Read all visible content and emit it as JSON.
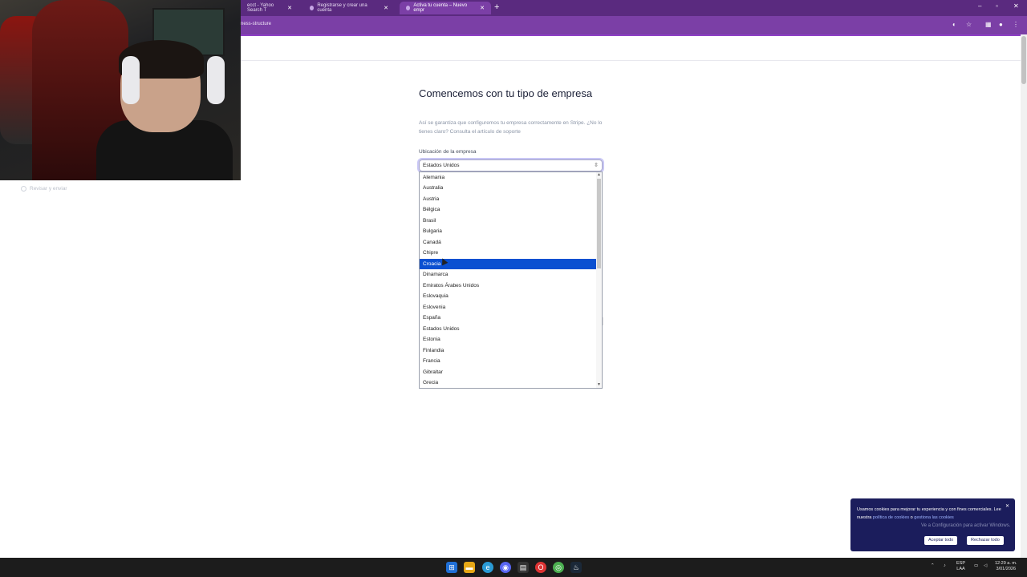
{
  "browser": {
    "tabs": [
      {
        "label": "ecct - Yahoo Search T",
        "active": false
      },
      {
        "label": "Registrarse y crear una cuenta",
        "active": false
      },
      {
        "label": "Activa tu cuenta – Nuevo empr",
        "active": true
      }
    ],
    "url_fragment": "ness-structure"
  },
  "page": {
    "title": "Comencemos con tu tipo de empresa",
    "subtitle": "Así se garantiza que configuremos tu empresa correctamente en Stripe. ¿No lo tienes claro? Consulta el artículo de soporte",
    "location_label": "Ubicación de la empresa",
    "selected_country": "Estados Unidos",
    "countries": [
      "Alemania",
      "Australia",
      "Austria",
      "Bélgica",
      "Brasil",
      "Bulgaria",
      "Canadá",
      "Chipre",
      "Croacia",
      "Dinamarca",
      "Emiratos Árabes Unidos",
      "Eslovaquia",
      "Eslovenia",
      "España",
      "Estados Unidos",
      "Estonia",
      "Finlandia",
      "Francia",
      "Gibraltar",
      "Grecia"
    ],
    "highlighted_country": "Croacia",
    "review_step": "Revisar y enviar"
  },
  "cookie_banner": {
    "text_before": "Usamos cookies para mejorar tu experiencia y con fines comerciales. Lee nuestra",
    "link1": "política de cookies",
    "text_mid": "o",
    "link2": "gestiona las cookies",
    "overlay_text": "Ve a Configuración para activar Windows.",
    "accept": "Aceptar todo",
    "reject": "Rechazar todo"
  },
  "taskbar": {
    "lang": "ESP",
    "lang2": "LAA",
    "time": "12:29 a. m.",
    "date": "3/01/2026"
  },
  "colors": {
    "chrome_purple": "#7b3fa6",
    "selection_blue": "#0b50d1",
    "cookie_bg": "#1b1d5c"
  }
}
